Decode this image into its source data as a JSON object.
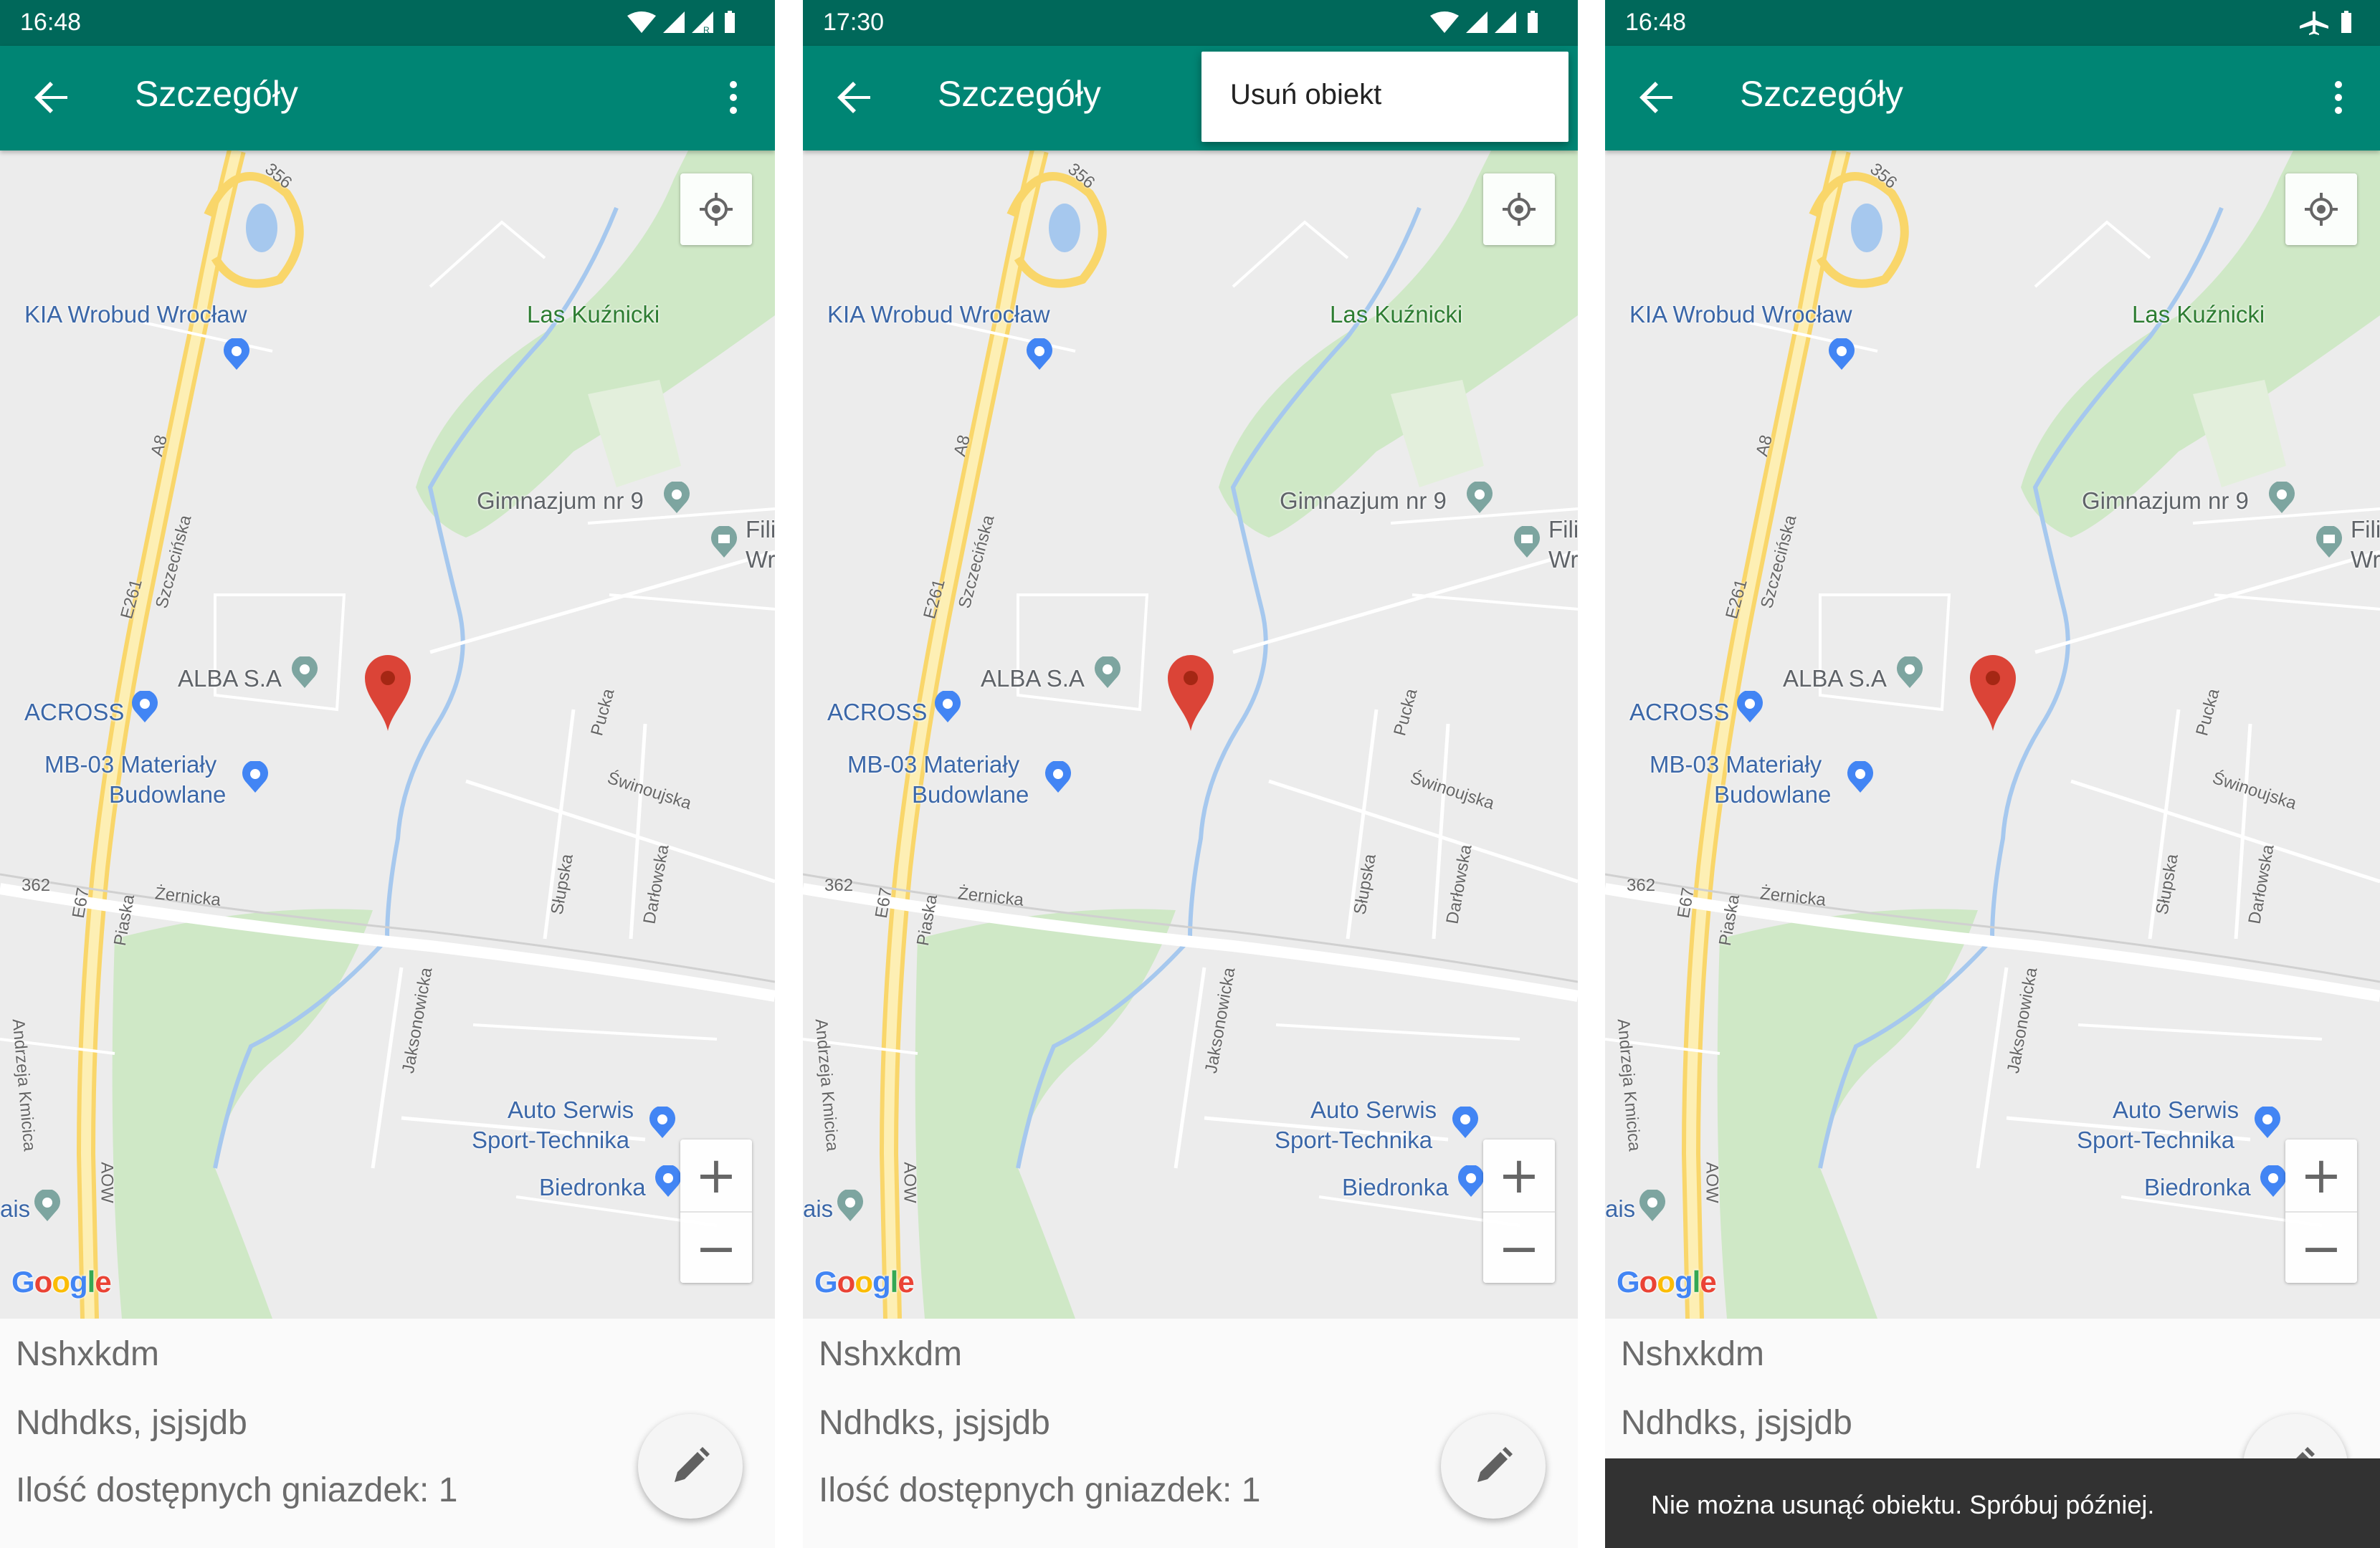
{
  "app": {
    "title": "Szczegóły",
    "back_icon": "arrow-back-icon",
    "overflow_icon": "more-vert-icon"
  },
  "colors": {
    "status_bar": "#00685a",
    "app_bar": "#008574",
    "marker": "#db4437",
    "snackbar": "#323232"
  },
  "screens": [
    {
      "status_time": "16:48",
      "status_icons": [
        "wifi-icon",
        "signal-icon",
        "signal-r-icon",
        "battery-icon"
      ]
    },
    {
      "status_time": "17:30",
      "status_icons": [
        "wifi-icon",
        "signal-icon",
        "signal-r-icon",
        "battery-icon"
      ],
      "menu": {
        "items": [
          "Usuń obiekt"
        ]
      }
    },
    {
      "status_time": "16:48",
      "status_icons": [
        "airplane-icon",
        "battery-icon"
      ],
      "snackbar": "Nie można usunąć obiektu. Spróbuj później."
    }
  ],
  "map": {
    "labels": {
      "kia": "KIA Wrobud Wrocław",
      "las": "Las Kuźnicki",
      "gimnazjum": "Gimnazjum nr 9",
      "fili1": "Fili",
      "fili2": "Wr",
      "alba": "ALBA S.A",
      "across": "ACROSS",
      "mb1": "MB-03 Materiały",
      "mb2": "Budowlane",
      "auto1": "Auto Serwis",
      "auto2": "Sport-Technika",
      "biedronka": "Biedronka",
      "ais": "ais"
    },
    "streets": {
      "r356": "356",
      "a8": "A8",
      "e261": "E261",
      "szczecinska": "Szczecińska",
      "pucka": "Pucka",
      "swinoujska": "Świnoujska",
      "r362": "362",
      "zernicka": "Żernicka",
      "e67": "E67",
      "piaska": "Piaska",
      "slupska": "Słupska",
      "darlowska": "Darłowska",
      "jaksonowicka": "Jaksonowicka",
      "knicica": "Andrzeja Kmicica",
      "aow": "AOW"
    },
    "google": [
      "G",
      "o",
      "o",
      "g",
      "l",
      "e"
    ],
    "zoom_in": "+",
    "zoom_out": "−"
  },
  "details": {
    "name": "Nshxkdm",
    "address": "Ndhdks, jsjsjdb",
    "sockets": "Ilość dostępnych gniazdek: 1",
    "edit_icon": "pencil-icon"
  }
}
